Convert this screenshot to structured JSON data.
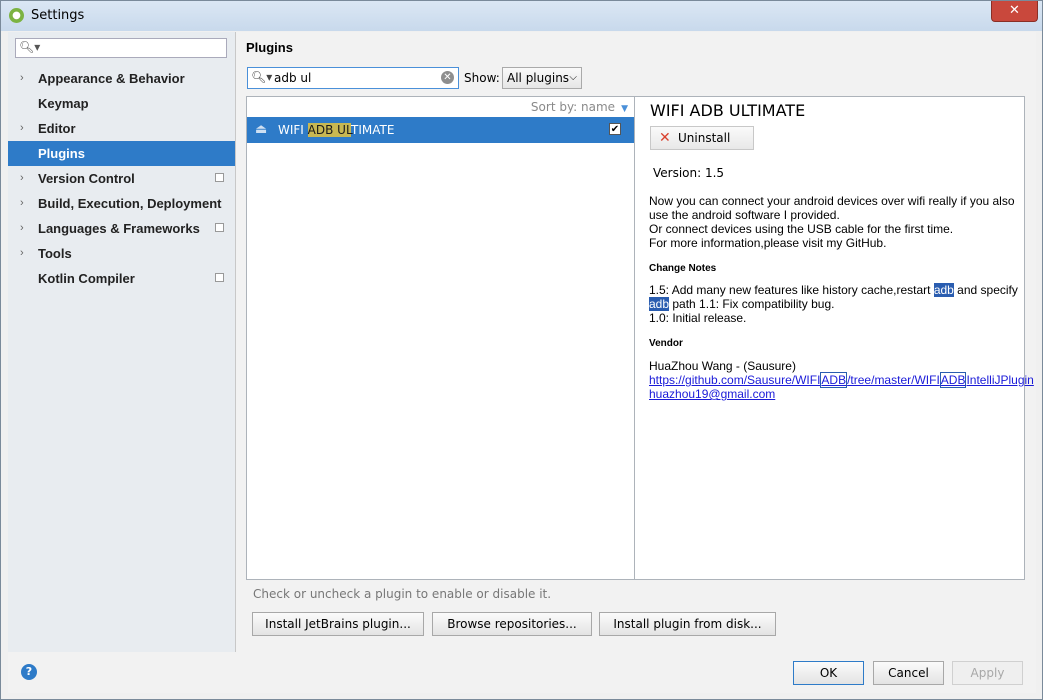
{
  "window": {
    "title": "Settings",
    "close_label": "✕"
  },
  "sidebar": {
    "search_placeholder": "",
    "items": [
      {
        "label": "Appearance & Behavior",
        "expandable": true,
        "project": false
      },
      {
        "label": "Keymap",
        "expandable": false,
        "project": false
      },
      {
        "label": "Editor",
        "expandable": true,
        "project": false
      },
      {
        "label": "Plugins",
        "expandable": false,
        "project": false,
        "selected": true
      },
      {
        "label": "Version Control",
        "expandable": true,
        "project": true
      },
      {
        "label": "Build, Execution, Deployment",
        "expandable": true,
        "project": false
      },
      {
        "label": "Languages & Frameworks",
        "expandable": true,
        "project": true
      },
      {
        "label": "Tools",
        "expandable": true,
        "project": false
      },
      {
        "label": "Kotlin Compiler",
        "expandable": false,
        "project": true
      }
    ]
  },
  "plugins": {
    "title": "Plugins",
    "search_value": "adb ul",
    "show_label": "Show:",
    "show_value": "All plugins",
    "sort_label": "Sort by: name",
    "list": [
      {
        "name_pre": "WIFI ",
        "name_match": "ADB UL",
        "name_post": "TIMATE",
        "enabled": true
      }
    ],
    "hint": "Check or uncheck a plugin to enable or disable it.",
    "buttons": {
      "install_jetbrains": "Install JetBrains plugin...",
      "browse": "Browse repositories...",
      "install_disk": "Install plugin from disk..."
    }
  },
  "detail": {
    "title": "WIFI ADB ULTIMATE",
    "uninstall_label": "Uninstall",
    "version": "Version: 1.5",
    "description": [
      "Now you can connect your android devices over wifi really if you also use the android software I provided.",
      "Or connect devices using the USB cable for the first time.",
      "For more information,please visit my GitHub."
    ],
    "change_notes_heading": "Change Notes",
    "notes": {
      "a": "1.5: Add many new features like history cache,restart ",
      "m1": "adb",
      "b": " and specify ",
      "m2": "adb",
      "c": " path 1.1: Fix compatibility bug.",
      "line2": "1.0: Initial release."
    },
    "vendor_heading": "Vendor",
    "vendor_name": "HuaZhou Wang - (Sausure)",
    "url": {
      "p1": "https://github.com/Sausure/WIFI",
      "m1": "ADB",
      "p2": "/tree/master/WIFI",
      "m2": "ADB",
      "p3": "IntelliJPlugin"
    },
    "email": "huazhou19@gmail.com"
  },
  "footer": {
    "help": "?",
    "ok": "OK",
    "cancel": "Cancel",
    "apply": "Apply"
  },
  "colors": {
    "selection": "#2e7bc8",
    "match_highlight": "#c8b852",
    "link": "#1a1ad8",
    "text_selection": "#2a5db0"
  }
}
